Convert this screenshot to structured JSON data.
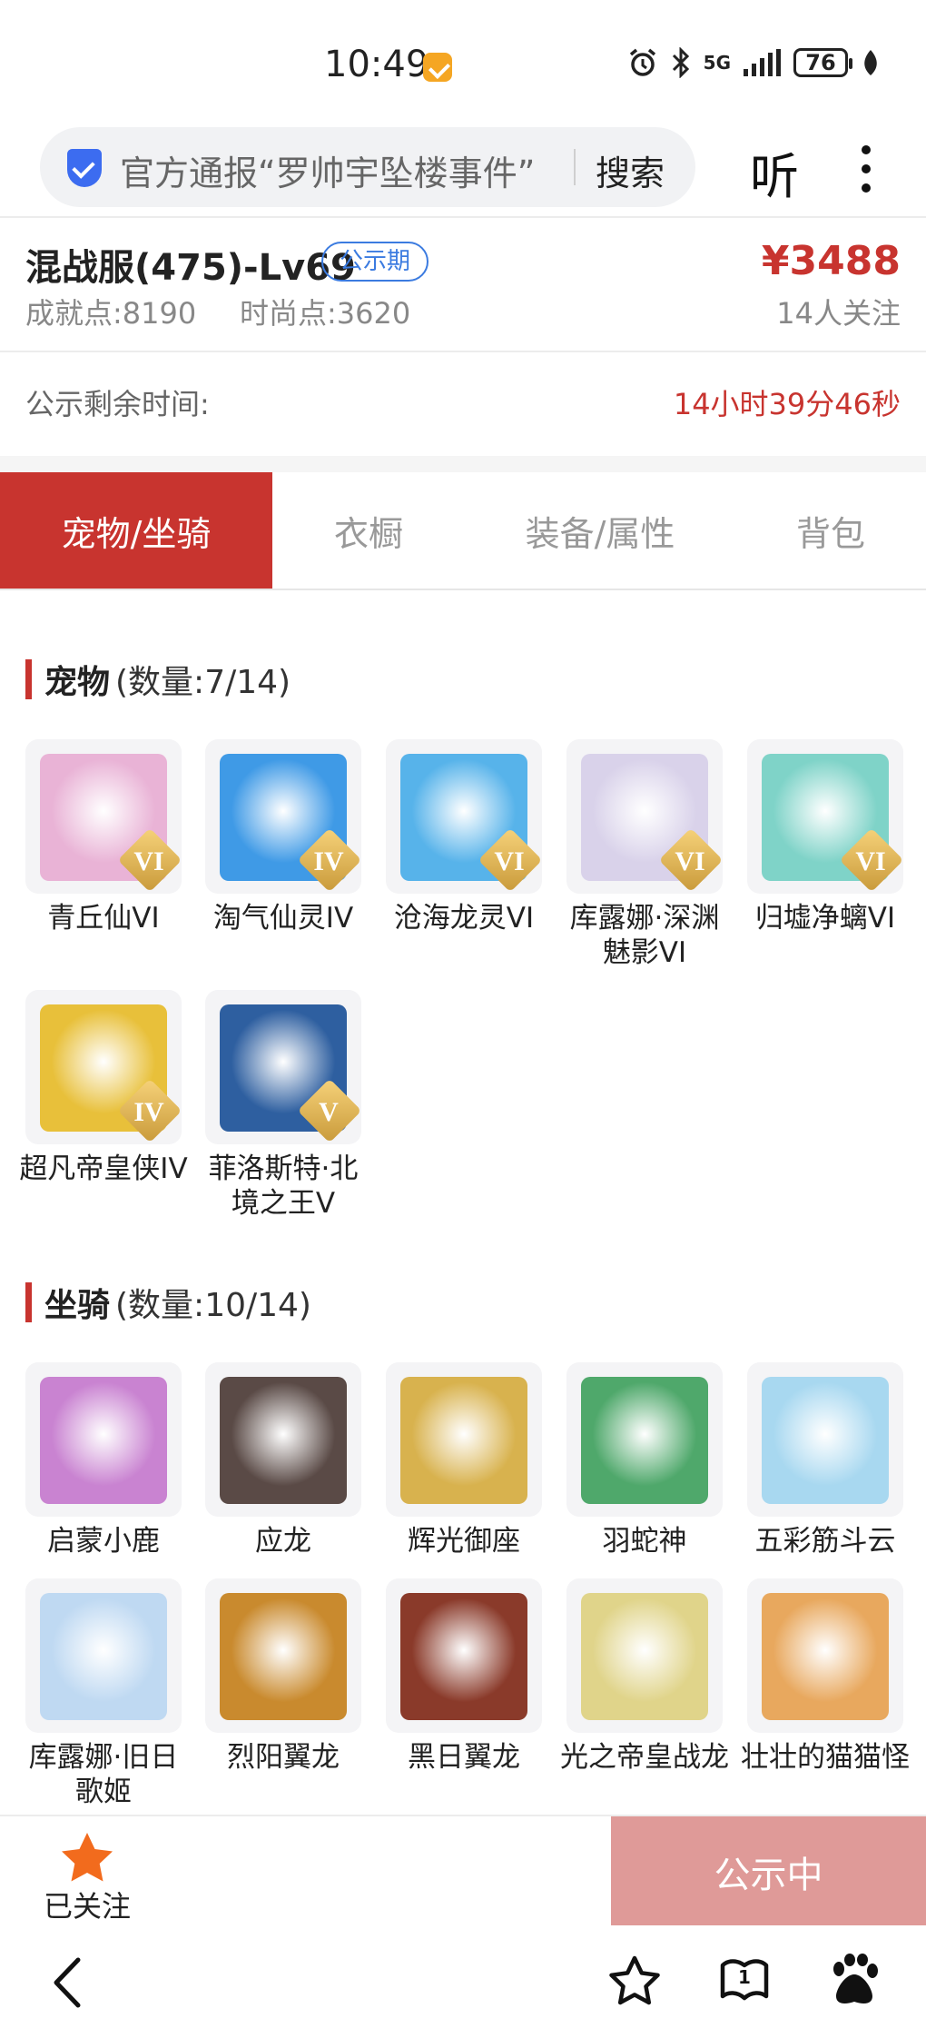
{
  "status_bar": {
    "time": "10:49",
    "network": "5G",
    "battery": "76"
  },
  "search": {
    "text": "官方通报“罗帅宇坠楼事件”",
    "button": "搜索"
  },
  "listen_label": "听",
  "header": {
    "server": "混战服(475)-Lv69",
    "period_badge": "公示期",
    "achievement": "成就点:8190",
    "fashion": "时尚点:3620",
    "price": "¥3488",
    "followers": "14人关注"
  },
  "remaining": {
    "label": "公示剩余时间:",
    "value": "14小时39分46秒"
  },
  "tabs": [
    {
      "label": "宠物/坐骑",
      "active": true
    },
    {
      "label": "衣橱"
    },
    {
      "label": "装备/属性"
    },
    {
      "label": "背包"
    }
  ],
  "pets": {
    "title": "宠物",
    "count": "(数量:7/14)",
    "items": [
      {
        "name": "青丘仙VI",
        "grade": "VI",
        "color": "#e9b3d6"
      },
      {
        "name": "淘气仙灵IV",
        "grade": "IV",
        "color": "#3f9ae6"
      },
      {
        "name": "沧海龙灵VI",
        "grade": "VI",
        "color": "#57b3ea"
      },
      {
        "name": "库露娜·深渊魅影VI",
        "grade": "VI",
        "color": "#d9d2ea"
      },
      {
        "name": "归墟净螭VI",
        "grade": "VI",
        "color": "#7fd3c8"
      },
      {
        "name": "超凡帝皇侠IV",
        "grade": "IV",
        "color": "#e8c03a"
      },
      {
        "name": "菲洛斯特·北境之王V",
        "grade": "V",
        "color": "#2e5fa0"
      }
    ]
  },
  "mounts": {
    "title": "坐骑",
    "count": "(数量:10/14)",
    "items": [
      {
        "name": "启蒙小鹿",
        "color": "#c983d1"
      },
      {
        "name": "应龙",
        "color": "#5a4a46"
      },
      {
        "name": "辉光御座",
        "color": "#d8b24e"
      },
      {
        "name": "羽蛇神",
        "color": "#4fa86b"
      },
      {
        "name": "五彩筋斗云",
        "color": "#a8d8f0"
      },
      {
        "name": "库露娜·旧日歌姬",
        "color": "#bfd9f2"
      },
      {
        "name": "烈阳翼龙",
        "color": "#c98a2e"
      },
      {
        "name": "黑日翼龙",
        "color": "#8a3a2a"
      },
      {
        "name": "光之帝皇战龙",
        "color": "#e0d48a"
      },
      {
        "name": "壮壮的猫猫怪",
        "color": "#e8a85e"
      }
    ]
  },
  "bottom": {
    "followed_label": "已关注",
    "publish_button": "公示中"
  },
  "colors": {
    "accent": "#c8342f",
    "publish_button": "#df9a98",
    "star": "#f26b1d"
  }
}
